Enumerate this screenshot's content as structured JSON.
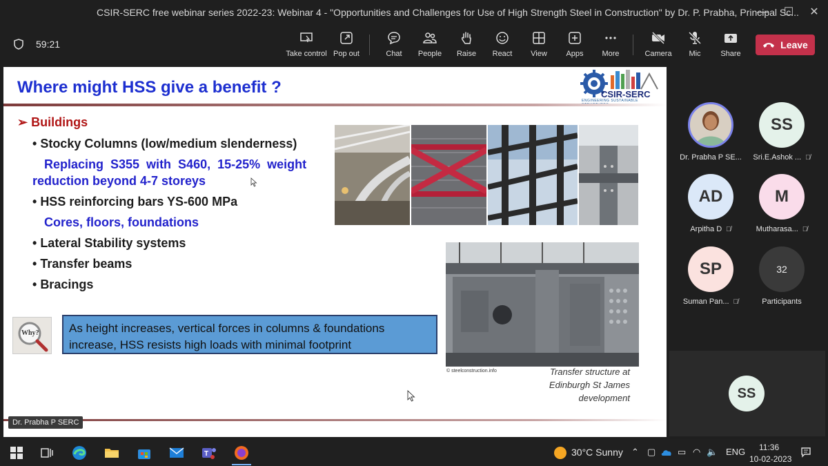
{
  "window": {
    "title": "CSIR-SERC free webinar series 2022-23: Webinar 4 - \"Opportunities and Challenges for Use of High Strength Steel in Construction\" by Dr. P. Prabha, Principal Sc...",
    "minimize": "—",
    "maximize": "☐",
    "close": "✕"
  },
  "toolbar": {
    "timer": "59:21",
    "buttons": {
      "take_control": "Take control",
      "pop_out": "Pop out",
      "chat": "Chat",
      "people": "People",
      "raise": "Raise",
      "react": "React",
      "view": "View",
      "apps": "Apps",
      "more": "More",
      "camera": "Camera",
      "mic": "Mic",
      "share": "Share"
    },
    "leave": "Leave"
  },
  "slide": {
    "title": "Where might HSS give a benefit ?",
    "logo_text": "CSIR-SERC",
    "logo_subtext": "ENGINEERING SUSTAINABLE STRUCTURES",
    "heading": "Buildings",
    "bullets": {
      "stocky": "Stocky Columns (low/medium slenderness)",
      "replacing": "Replacing  S355  with  S460,  15-25%  weight",
      "reduction": "reduction beyond 4-7 storeys",
      "rebar": "HSS reinforcing bars YS-600 MPa",
      "cores": "Cores, floors, foundations",
      "lateral": "Lateral Stability systems",
      "transfer": "Transfer beams",
      "bracings": "Bracings"
    },
    "why_label": "Why?",
    "callout_line1": "As height increases, vertical forces in columns & foundations",
    "callout_line2": "increase, HSS resists high loads with minimal footprint",
    "credit": "© steelconstruction.info",
    "caption_line1": "Transfer structure at",
    "caption_line2": "Edinburgh St James",
    "caption_line3": "development"
  },
  "presenter_tag": "Dr. Prabha P SERC",
  "participants": [
    {
      "name": "Dr. Prabha P SE...",
      "initials": "",
      "muted": false
    },
    {
      "name": "Sri.E.Ashok ...",
      "initials": "SS",
      "muted": true,
      "color": "#e4f2ea"
    },
    {
      "name": "Arpitha D",
      "initials": "AD",
      "muted": true,
      "color": "#dbe8f8"
    },
    {
      "name": "Mutharasa...",
      "initials": "M",
      "muted": true,
      "color": "#fadcea"
    },
    {
      "name": "Suman Pan...",
      "initials": "SP",
      "muted": true,
      "color": "#fbe2df"
    },
    {
      "name": "Participants",
      "initials": "32",
      "muted": false,
      "color": "#3a3a3a"
    }
  ],
  "self_view": {
    "initials": "SS"
  },
  "taskbar": {
    "weather": "30°C  Sunny",
    "language": "ENG",
    "time": "11:36",
    "date": "10-02-2023"
  }
}
